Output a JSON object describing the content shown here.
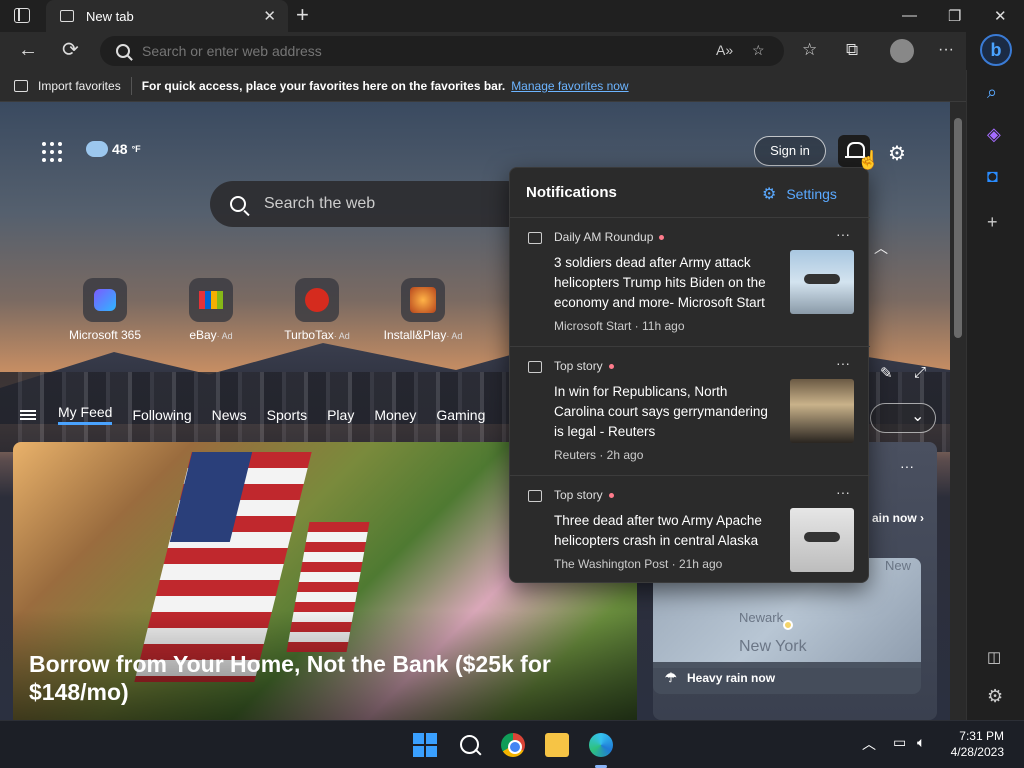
{
  "browser": {
    "tab_title": "New tab",
    "new_tab_symbol": "+",
    "tab_close_symbol": "✕",
    "address_placeholder": "Search or enter web address",
    "window_controls": {
      "minimize": "—",
      "restore": "❐",
      "close": "✕"
    },
    "nav": {
      "back": "←",
      "refresh": "⟳",
      "more": "···"
    }
  },
  "favorites_bar": {
    "import_label": "Import favorites",
    "hint": "For quick access, place your favorites here on the favorites bar.",
    "manage_link": "Manage favorites now"
  },
  "newtab": {
    "weather_temp": "48",
    "weather_unit": "°F",
    "sign_in": "Sign in",
    "search_label": "Search the web",
    "quick_links": [
      {
        "label": "Microsoft 365",
        "ad": ""
      },
      {
        "label": "eBay",
        "ad": "· Ad"
      },
      {
        "label": "TurboTax",
        "ad": "· Ad"
      },
      {
        "label": "Install&Play",
        "ad": "· Ad"
      }
    ],
    "feed_tabs": [
      "My Feed",
      "Following",
      "News",
      "Sports",
      "Play",
      "Money",
      "Gaming"
    ],
    "hero_headline": "Borrow from Your Home, Not the Bank ($25k for $148/mo)",
    "weather_card": {
      "rain_now": "ain now",
      "map_label_ny": "New York",
      "map_label_newark": "Newark",
      "map_label_new": "New",
      "heavy_rain": "Heavy rain now"
    }
  },
  "notifications": {
    "title": "Notifications",
    "settings_label": "Settings",
    "items": [
      {
        "source": "Daily AM Roundup",
        "title": "3 soldiers dead after Army attack helicopters Trump hits Biden on the economy and more- Microsoft Start",
        "meta": "Microsoft Start · 11h ago"
      },
      {
        "source": "Top story",
        "title": "In win for Republicans, North Carolina court says gerrymandering is legal - Reuters",
        "meta": "Reuters · 2h ago"
      },
      {
        "source": "Top story",
        "title": "Three dead after two Army Apache helicopters crash in central Alaska",
        "meta": "The Washington Post · 21h ago"
      }
    ],
    "more_symbol": "···"
  },
  "taskbar": {
    "time": "7:31 PM",
    "date": "4/28/2023"
  },
  "colors": {
    "accent": "#4aa3ff",
    "link": "#6cb4ff",
    "panel_bg": "#2b2b2b",
    "chrome_bg": "#202020"
  }
}
